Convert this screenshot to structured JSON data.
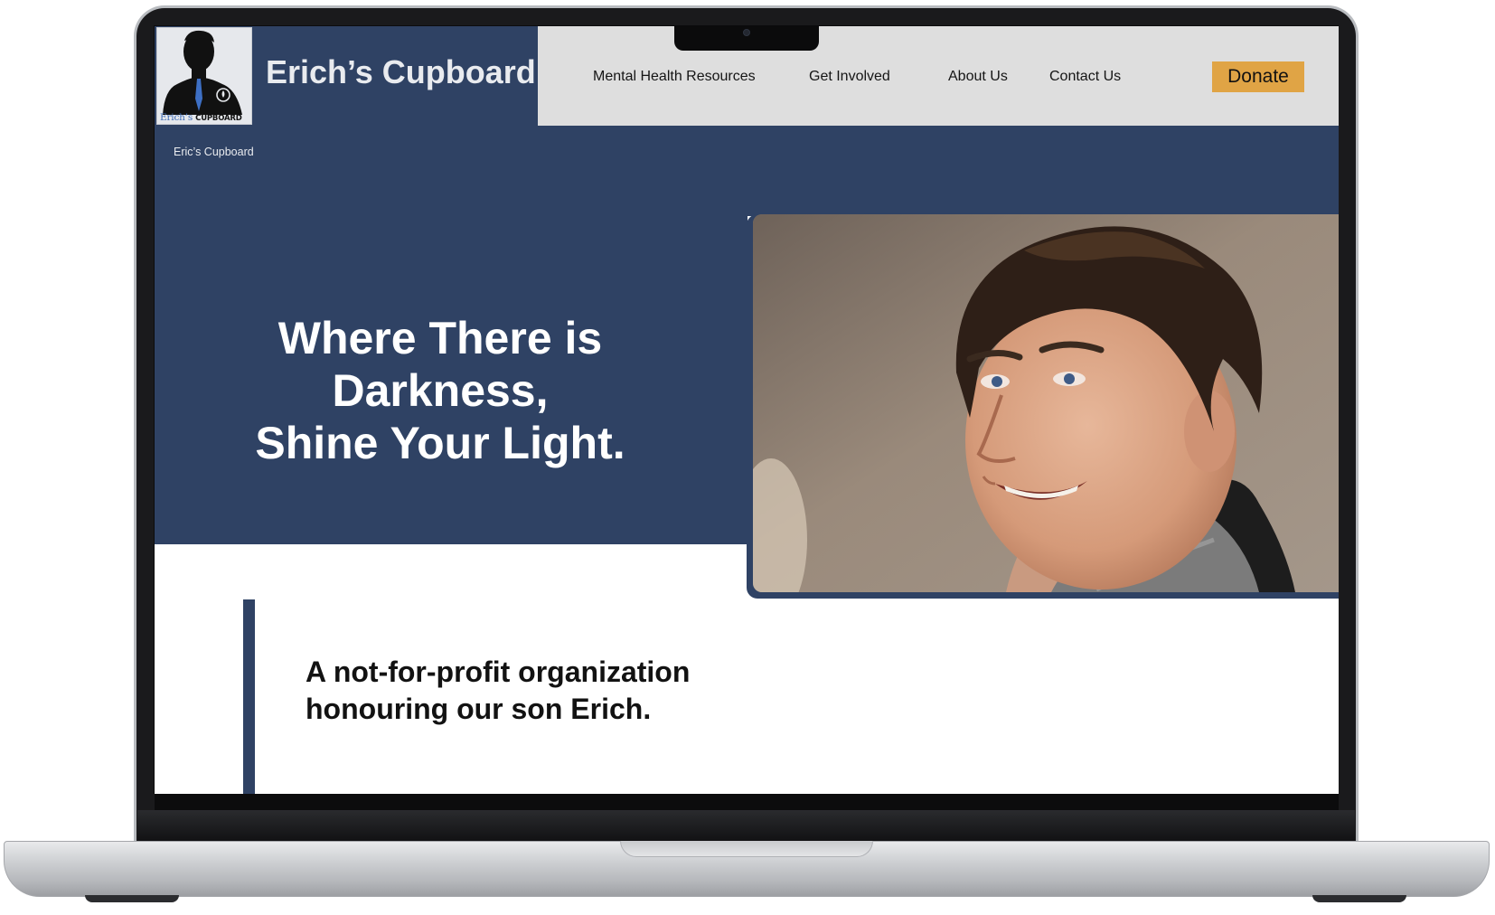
{
  "site": {
    "name": "Erich’s Cupboard",
    "breadcrumb": "Eric’s Cupboard",
    "logo": {
      "caption_script": "Erich’s",
      "caption_bold": "CUPBOARD",
      "icon": "silhouette-candle-logo"
    }
  },
  "nav": {
    "items": [
      {
        "label": "Mental Health Resources"
      },
      {
        "label": "Get Involved"
      },
      {
        "label": "About Us"
      },
      {
        "label": "Contact Us"
      }
    ],
    "donate_label": "Donate"
  },
  "hero": {
    "headline_line1": "Where There is Darkness,",
    "headline_line2": "Shine Your Light.",
    "photo": "portrait-photo"
  },
  "intro": {
    "line1": "A not-for-profit organization",
    "line2": "honouring our son Erich."
  },
  "colors": {
    "navy": "#2f4264",
    "nav_bg": "#dedede",
    "donate_bg": "#e0a445",
    "text_dark": "#121212",
    "text_light": "#ffffff"
  }
}
